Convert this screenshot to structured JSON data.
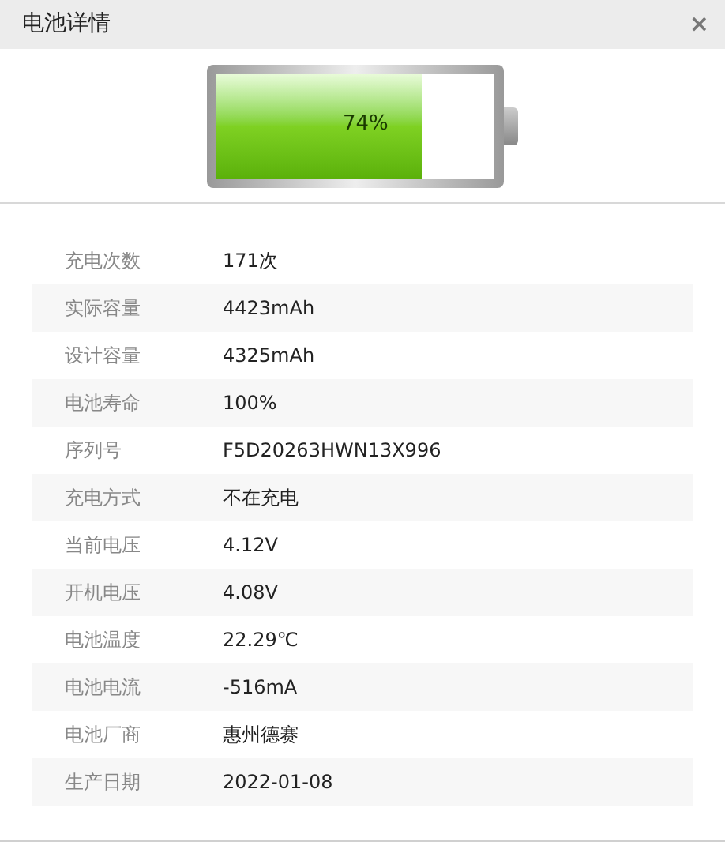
{
  "window": {
    "title": "电池详情",
    "close": "×"
  },
  "battery": {
    "level": 0.74,
    "reading": "74%"
  },
  "rows": [
    {
      "label": "充电次数",
      "value": "171次"
    },
    {
      "label": "实际容量",
      "value": "4423mAh"
    },
    {
      "label": "设计容量",
      "value": "4325mAh"
    },
    {
      "label": "电池寿命",
      "value": "100%"
    },
    {
      "label": "序列号",
      "value": "F5D20263HWN13X996"
    },
    {
      "label": "充电方式",
      "value": "不在充电"
    },
    {
      "label": "当前电压",
      "value": "4.12V"
    },
    {
      "label": "开机电压",
      "value": "4.08V"
    },
    {
      "label": "电池温度",
      "value": "22.29℃"
    },
    {
      "label": "电池电流",
      "value": "-516mA"
    },
    {
      "label": "电池厂商",
      "value": "惠州德赛"
    },
    {
      "label": "生产日期",
      "value": "2022-01-08"
    }
  ]
}
